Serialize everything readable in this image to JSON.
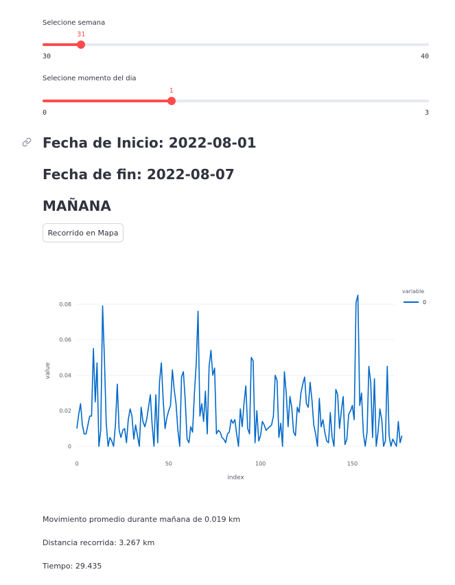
{
  "slider_week": {
    "label": "Selecione semana",
    "min": "30",
    "max": "40",
    "value": "31",
    "fraction": 0.1
  },
  "slider_moment": {
    "label": "Selecione momento del dia",
    "min": "0",
    "max": "3",
    "value": "1",
    "fraction": 0.3333
  },
  "headings": {
    "start": "Fecha de Inicio: 2022-08-01",
    "end": "Fecha de fin: 2022-08-07",
    "period": "MAÑANA"
  },
  "map_button": "Recorrido en Mapa",
  "stats": {
    "movement": "Movimiento promedio durante mañana de 0.019 km",
    "distance": "Distancia recorrida: 3.267 km",
    "time": "Tiempo: 29.435"
  },
  "colors": {
    "accent": "#ff4b4b",
    "line": "#0068c9",
    "text": "#31333f"
  },
  "chart_data": {
    "type": "line",
    "xlabel": "index",
    "ylabel": "value",
    "legend_title": "variable",
    "legend_position": "top-right",
    "xlim": [
      0,
      173
    ],
    "ylim": [
      0,
      0.085
    ],
    "xticks": [
      0,
      50,
      100,
      150
    ],
    "yticks": [
      0,
      0.02,
      0.04,
      0.06,
      0.08
    ],
    "ytick_labels": [
      "0",
      "0.02",
      "0.04",
      "0.06",
      "0.08"
    ],
    "grid": true,
    "series": [
      {
        "name": "0",
        "values": [
          0.01,
          0.018,
          0.024,
          0.012,
          0.007,
          0.007,
          0.012,
          0.017,
          0.017,
          0.055,
          0.025,
          0.047,
          0,
          0.009,
          0.079,
          0.05,
          0.013,
          0,
          0.005,
          0.003,
          0,
          0.012,
          0.035,
          0.009,
          0.005,
          0.009,
          0.01,
          0.002,
          0.015,
          0.021,
          0.017,
          0.004,
          0.012,
          0.006,
          0,
          0.022,
          0.014,
          0.011,
          0.015,
          0.022,
          0.029,
          0.012,
          0,
          0.029,
          0.002,
          0.036,
          0.047,
          0.026,
          0.01,
          0.016,
          0.02,
          0.023,
          0.043,
          0.032,
          0.024,
          0.009,
          0,
          0.039,
          0.042,
          0.026,
          0.004,
          0.002,
          0.011,
          0.008,
          0.03,
          0.047,
          0.076,
          0.017,
          0.024,
          0.014,
          0.031,
          0.007,
          0.045,
          0.054,
          0.04,
          0.044,
          0.007,
          0.009,
          0.008,
          0.005,
          0.004,
          0.002,
          0.007,
          0.008,
          0.015,
          0.013,
          0.015,
          0.007,
          0,
          0.021,
          0.011,
          0.024,
          0.034,
          0.01,
          0.007,
          0.05,
          0.048,
          0.002,
          0.02,
          0.003,
          0.006,
          0.014,
          0.012,
          0.009,
          0.01,
          0.011,
          0.012,
          0.017,
          0.04,
          0.037,
          0.005,
          0.013,
          0,
          0.042,
          0.03,
          0.011,
          0.028,
          0.022,
          0.008,
          0.006,
          0.022,
          0.019,
          0.03,
          0.035,
          0.039,
          0.024,
          0.022,
          0.036,
          0.026,
          0.012,
          0.007,
          0,
          0.027,
          0.011,
          0.015,
          0.008,
          0.003,
          0.002,
          0.019,
          0.005,
          0,
          0.032,
          0.029,
          0.01,
          0.02,
          0.028,
          0.001,
          0.004,
          0.018,
          0.02,
          0.023,
          0.015,
          0.081,
          0.085,
          0.023,
          0.03,
          0.007,
          0,
          0.008,
          0.045,
          0.036,
          0.005,
          0.038,
          0,
          0.008,
          0.021,
          0.015,
          0,
          0.003,
          0.045,
          0.006,
          0,
          0.004,
          0.002,
          0,
          0.014,
          0.002,
          0.006
        ]
      }
    ]
  }
}
